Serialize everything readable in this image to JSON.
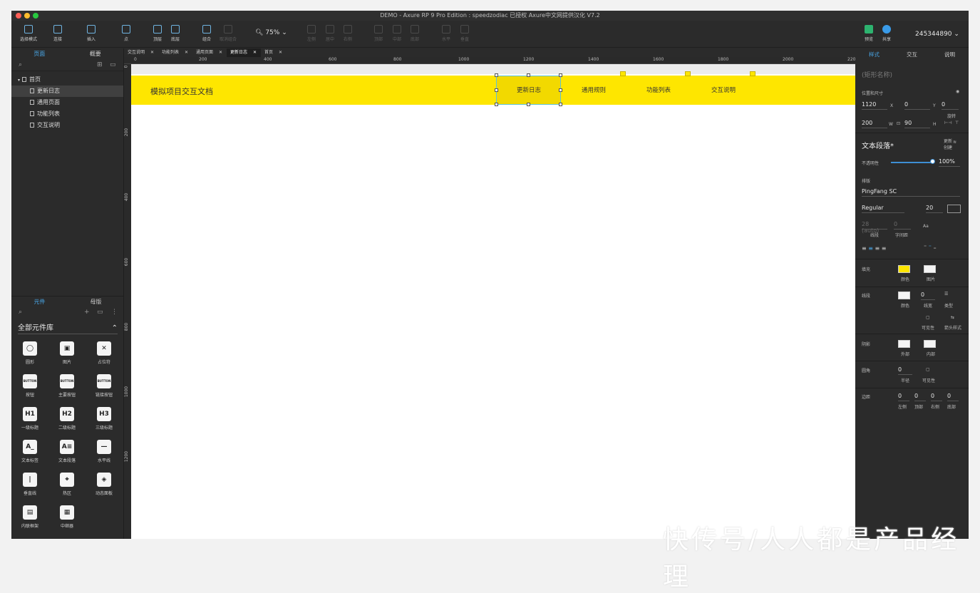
{
  "window": {
    "title": "DEMO - Axure RP 9 Pro Edition : speedzodiac 已授权     Axure中文网提供汉化 V7.2"
  },
  "toolbar": {
    "select_mode": "选择模式",
    "connect": "连接",
    "insert": "插入",
    "point": "点",
    "top": "顶层",
    "bottom": "底层",
    "group": "组合",
    "ungroup": "取消组合",
    "zoom": "75%",
    "align_left": "左侧",
    "align_center": "居中",
    "align_right": "右侧",
    "align_top": "顶部",
    "align_middle": "中部",
    "align_bottom": "底部",
    "dist_h": "水平",
    "dist_v": "垂直",
    "preview": "预览",
    "share": "共享",
    "account": "245344890"
  },
  "left_panel": {
    "tabs": [
      "页面",
      "概要"
    ],
    "pages": [
      {
        "label": "首页",
        "level": 0,
        "selected": false
      },
      {
        "label": "更新日志",
        "level": 1,
        "selected": true
      },
      {
        "label": "通用页面",
        "level": 1,
        "selected": false
      },
      {
        "label": "功能列表",
        "level": 1,
        "selected": false
      },
      {
        "label": "交互说明",
        "level": 1,
        "selected": false
      }
    ],
    "lib_tabs": [
      "元件",
      "母版"
    ],
    "library_select": "全部元件库",
    "widgets": [
      {
        "icon": "◯",
        "label": "圆形"
      },
      {
        "icon": "▣",
        "label": "图片"
      },
      {
        "icon": "✕",
        "label": "占位符"
      },
      {
        "icon": "BUTTON",
        "label": "按钮"
      },
      {
        "icon": "BUTTON",
        "label": "主要按钮"
      },
      {
        "icon": "BUTTON",
        "label": "链接按钮"
      },
      {
        "icon": "H1",
        "label": "一级标题"
      },
      {
        "icon": "H2",
        "label": "二级标题"
      },
      {
        "icon": "H3",
        "label": "三级标题"
      },
      {
        "icon": "A_",
        "label": "文本标签"
      },
      {
        "icon": "A≡",
        "label": "文本段落"
      },
      {
        "icon": "—",
        "label": "水平线"
      },
      {
        "icon": "|",
        "label": "垂直线"
      },
      {
        "icon": "⌖",
        "label": "热区"
      },
      {
        "icon": "◈",
        "label": "动态面板"
      },
      {
        "icon": "▤",
        "label": "内联框架"
      },
      {
        "icon": "▦",
        "label": "中继器"
      }
    ]
  },
  "doc_tabs": [
    "交互说明",
    "功能列表",
    "通用页面",
    "更新日志",
    "首页"
  ],
  "active_doc_tab": "更新日志",
  "ruler_h": [
    "0",
    "200",
    "400",
    "600",
    "800",
    "1000",
    "1200",
    "1400",
    "1600",
    "1800",
    "2000",
    "220"
  ],
  "ruler_v": [
    "0",
    "200",
    "400",
    "600",
    "800",
    "1000",
    "1200"
  ],
  "canvas": {
    "site_title": "模拟项目交互文档",
    "nav": [
      "更新日志",
      "通用规则",
      "功能列表",
      "交互说明"
    ]
  },
  "right_panel": {
    "tabs": [
      "样式",
      "交互",
      "说明"
    ],
    "shape_name_placeholder": "(矩形名称)",
    "pos_size": "位置和尺寸",
    "x": "1120",
    "y": "0",
    "rotation": "0",
    "w": "200",
    "h": "90",
    "x_label": "X",
    "y_label": "Y",
    "rot_label": "旋转",
    "w_label": "W",
    "h_label": "H",
    "style_name": "文本段落*",
    "update": "更新",
    "create": "创建",
    "opacity_label": "不透明性",
    "opacity": "100%",
    "typography_label": "排版",
    "font_family": "PingFang SC",
    "font_weight": "Regular",
    "font_size": "20",
    "line_height": "28 (auto)",
    "letter_spacing": "0",
    "line_label": "线段",
    "spacing_label": "字间距",
    "fill_label": "填充",
    "fill_color_label": "颜色",
    "fill_image_label": "图片",
    "fill_color": "#fee600",
    "border_label": "线段",
    "border_color_label": "颜色",
    "border_width": "0",
    "border_width_label": "线宽",
    "border_type_label": "类型",
    "visibility_label": "可见性",
    "arrow_label": "箭头样式",
    "shadow_label": "阴影",
    "shadow_outer": "外部",
    "shadow_inner": "内部",
    "radius_label": "圆角",
    "radius": "0",
    "radius_sub": "半径",
    "radius_vis": "可见性",
    "padding_label": "边距",
    "padding": [
      "0",
      "0",
      "0",
      "0"
    ],
    "padding_sub": [
      "左侧",
      "顶部",
      "右侧",
      "底部"
    ]
  },
  "watermark": "快传号/人人都是产品经理",
  "colors": {
    "accent": "#49a8ea",
    "banner": "#fee600",
    "selection": "#5fc3d8"
  }
}
